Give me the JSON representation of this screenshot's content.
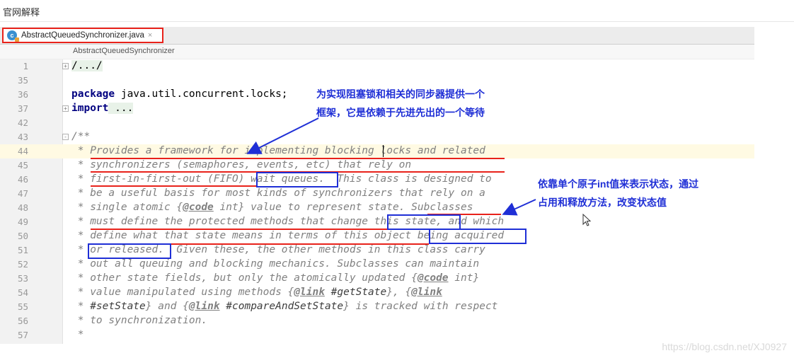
{
  "window": {
    "title": "官网解释"
  },
  "tab": {
    "icon_letter": "c",
    "label": "AbstractQueuedSynchronizer.java",
    "close_glyph": "×"
  },
  "breadcrumb": "AbstractQueuedSynchronizer",
  "lines": [
    {
      "num": "1",
      "text": "/.../"
    },
    {
      "num": "35",
      "text": ""
    },
    {
      "num": "36",
      "kw": "package",
      "text": " java.util.concurrent.locks;"
    },
    {
      "num": "37",
      "kw": "import",
      "text": " ..."
    },
    {
      "num": "42",
      "text": ""
    },
    {
      "num": "43",
      "text": "/**"
    },
    {
      "num": "44",
      "text": " * Provides a framework for implementing blocking locks and related"
    },
    {
      "num": "45",
      "text": " * synchronizers (semaphores, events, etc) that rely on"
    },
    {
      "num": "46",
      "text": " * first-in-first-out (FIFO) wait queues.  This class is designed to"
    },
    {
      "num": "47",
      "text": " * be a useful basis for most kinds of synchronizers that rely on a"
    },
    {
      "num": "48",
      "pre": " * single atomic {",
      "tag": "@code",
      "post": " int} value to represent state. Subclasses"
    },
    {
      "num": "49",
      "text": " * must define the protected methods that change this state, and which"
    },
    {
      "num": "50",
      "text": " * define what that state means in terms of this object being acquired"
    },
    {
      "num": "51",
      "text": " * or released.  Given these, the other methods in this class carry"
    },
    {
      "num": "52",
      "text": " * out all queuing and blocking mechanics. Subclasses can maintain"
    },
    {
      "num": "53",
      "pre": " * other state fields, but only the atomically updated {",
      "tag": "@code",
      "post": " int}"
    },
    {
      "num": "54",
      "pre": " * value manipulated using methods {",
      "tag": "@link",
      "ref": " #getState",
      "post": "}, {",
      "tag2": "@link"
    },
    {
      "num": "55",
      "pre": " * ",
      "ref": "#setState",
      "post": "} and {",
      "tag": "@link",
      "ref2": " #compareAndSetState",
      "post2": "} is tracked with respect"
    },
    {
      "num": "56",
      "text": " * to synchronization."
    },
    {
      "num": "57",
      "text": " *"
    }
  ],
  "annotations": {
    "first": [
      "为实现阻塞锁和相关的同步器提供一个",
      "框架，它是依赖于先进先出的一个等待"
    ],
    "second": [
      "依靠单个原子int值来表示状态，通过",
      "占用和释放方法，改变状态值"
    ]
  },
  "colors": {
    "annotation_blue": "#1f2fd6",
    "highlight_red": "#e8221b",
    "tab_border": "#e8221b"
  },
  "watermark": "https://blog.csdn.net/XJ0927"
}
